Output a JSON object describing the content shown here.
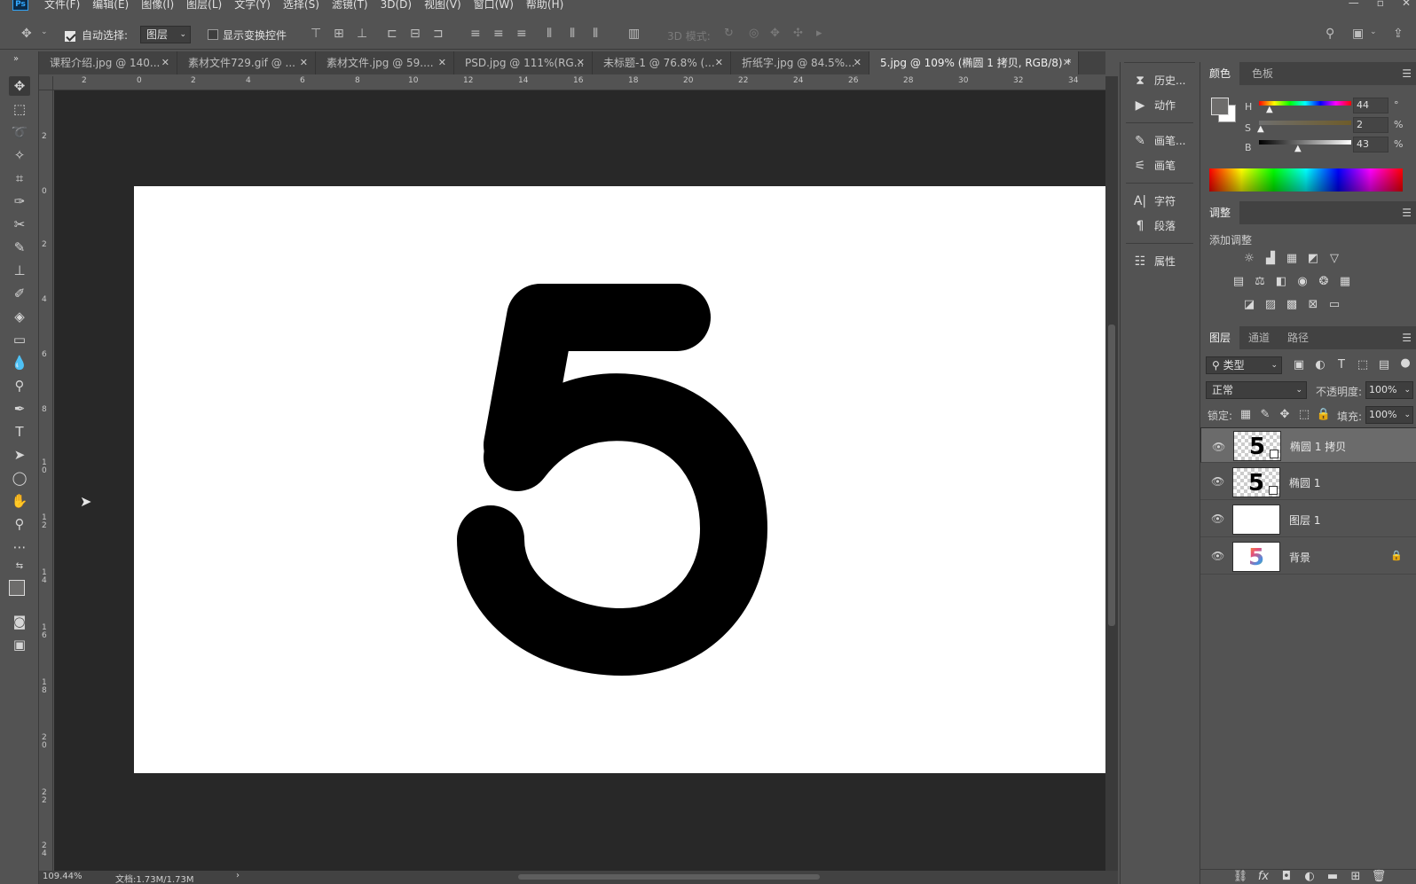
{
  "app": {
    "logo": "Ps"
  },
  "menu": [
    "文件(F)",
    "编辑(E)",
    "图像(I)",
    "图层(L)",
    "文字(Y)",
    "选择(S)",
    "滤镜(T)",
    "3D(D)",
    "视图(V)",
    "窗口(W)",
    "帮助(H)"
  ],
  "options": {
    "auto_select_label": "自动选择:",
    "auto_select_value": "图层",
    "show_transform_label": "显示变换控件",
    "mode_3d_label": "3D 模式:"
  },
  "tabs": [
    {
      "label": "课程介绍.jpg @ 140...",
      "active": false
    },
    {
      "label": "素材文件729.gif @ ...",
      "active": false
    },
    {
      "label": "素材文件.jpg @ 59....",
      "active": false
    },
    {
      "label": "PSD.jpg @ 111%(RG...",
      "active": false
    },
    {
      "label": "未标题-1 @ 76.8% (...",
      "active": false
    },
    {
      "label": "折纸字.jpg @ 84.5%...",
      "active": false
    },
    {
      "label": "5.jpg @ 109% (椭圆 1 拷贝, RGB/8) *",
      "active": true
    }
  ],
  "ruler_top": [
    "2",
    "0",
    "2",
    "4",
    "6",
    "8",
    "10",
    "12",
    "14",
    "16",
    "18",
    "20",
    "22",
    "24",
    "26",
    "28",
    "30",
    "32",
    "34"
  ],
  "ruler_left": [
    "2",
    "0",
    "2",
    "4",
    "6",
    "8",
    "10",
    "12",
    "14",
    "16",
    "18",
    "20",
    "22",
    "24"
  ],
  "canvas": {
    "glyph": "5"
  },
  "status": {
    "zoom": "109.44%",
    "doc": "文档:1.73M/1.73M"
  },
  "mid_panel": [
    {
      "icon": "history-icon",
      "label": "历史..."
    },
    {
      "icon": "actions-icon",
      "label": "动作"
    },
    {
      "icon": "brush-presets-icon",
      "label": "画笔..."
    },
    {
      "icon": "brush-icon",
      "label": "画笔"
    },
    {
      "icon": "character-icon",
      "label": "字符"
    },
    {
      "icon": "paragraph-icon",
      "label": "段落"
    },
    {
      "icon": "properties-icon",
      "label": "属性"
    }
  ],
  "color_panel": {
    "tabs": [
      "颜色",
      "色板"
    ],
    "h_label": "H",
    "s_label": "S",
    "b_label": "B",
    "h_value": "44",
    "s_value": "2",
    "b_value": "43",
    "h_unit": "°",
    "s_unit": "%",
    "b_unit": "%",
    "foreground": "#6d6c6b",
    "background": "#ffffff"
  },
  "adjust_panel": {
    "title": "调整",
    "add_label": "添加调整"
  },
  "layers_panel": {
    "tabs": [
      "图层",
      "通道",
      "路径"
    ],
    "filter_label": "类型",
    "blend_mode": "正常",
    "opacity_label": "不透明度:",
    "opacity_value": "100%",
    "lock_label": "锁定:",
    "fill_label": "填充:",
    "fill_value": "100%",
    "layers": [
      {
        "name": "椭圆 1 拷贝",
        "thumb": "5",
        "selected": true
      },
      {
        "name": "椭圆 1",
        "thumb": "5",
        "selected": false
      },
      {
        "name": "图层 1",
        "thumb": "",
        "selected": false
      },
      {
        "name": "背景",
        "thumb": "5",
        "selected": false,
        "locked": true
      }
    ]
  }
}
